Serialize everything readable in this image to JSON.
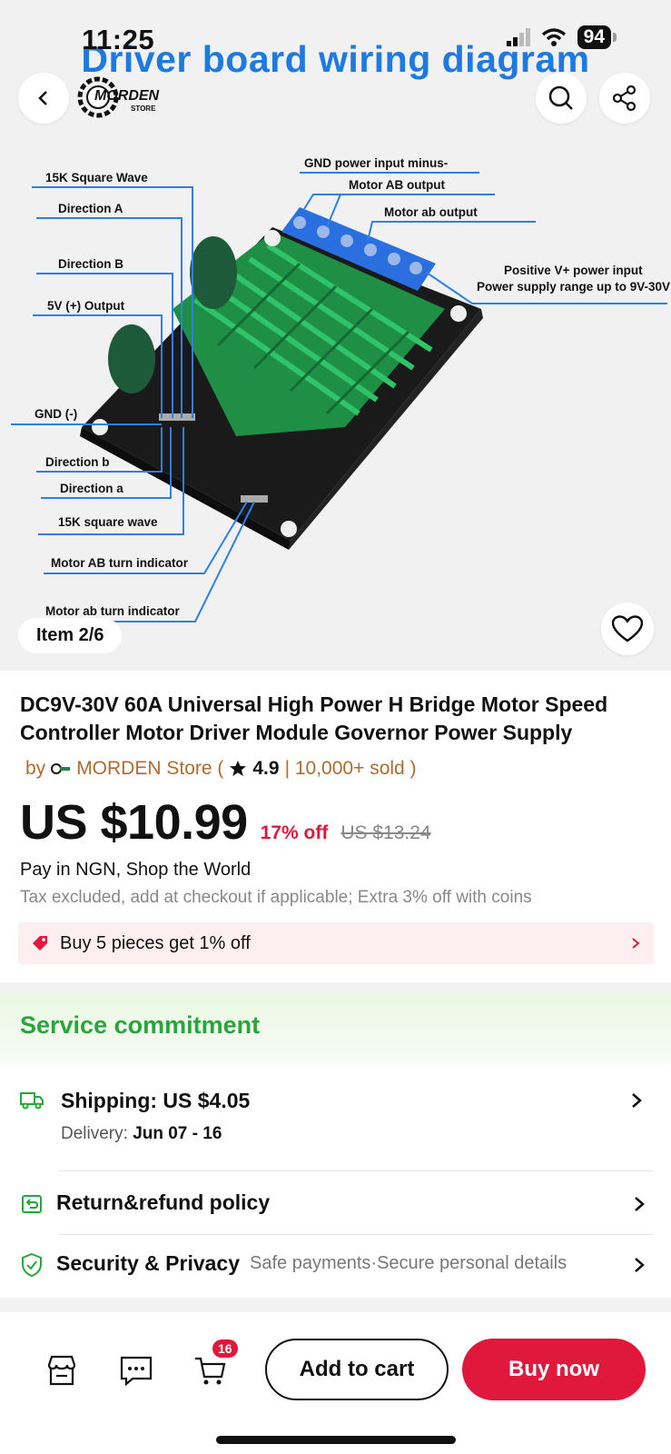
{
  "status_bar": {
    "time": "11:25",
    "battery": "94"
  },
  "hero": {
    "title": "Driver board wiring diagram",
    "logo_text": "MORDEN",
    "logo_sub": "STORE",
    "item_counter": "Item 2/6",
    "labels": {
      "sq_wave_15k": "15K Square Wave",
      "direction_A": "Direction A",
      "direction_B": "Direction B",
      "out_5v": "5V (+) Output",
      "gnd": "GND  (-)",
      "direction_b": "Direction b",
      "direction_a": "Direction a",
      "sq_wave_15k_lower": "15K square wave",
      "motor_AB_turn": "Motor AB turn indicator",
      "motor_ab_turn": "Motor ab turn indicator",
      "gnd_power": "GND power input minus-",
      "motor_AB_out": "Motor AB output",
      "motor_ab_out": "Motor ab output",
      "pos_power": "Positive V+ power input",
      "power_range": "Power supply range up to 9V-30V"
    },
    "icons": {
      "back": "back-arrow-icon",
      "search": "search-icon",
      "share": "share-icon",
      "wishlist": "heart-icon"
    }
  },
  "product": {
    "title": "DC9V-30V 60A Universal High Power H Bridge Motor Speed Controller Motor Driver Module Governor Power Supply",
    "store_prefix": "by",
    "store_name": "MORDEN Store (",
    "rating": "4.9",
    "sold": "| 10,000+ sold )",
    "price": "US $10.99",
    "discount": "17% off",
    "original_price": "US $13.24",
    "pay_line": "Pay in NGN, Shop the World",
    "tax_line": "Tax excluded, add at checkout if applicable; Extra 3% off with coins",
    "promo": "Buy 5 pieces get 1% off"
  },
  "service": {
    "heading": "Service commitment",
    "shipping_title": "Shipping: US $4.05",
    "delivery_label": "Delivery:",
    "delivery_dates": "Jun 07 - 16",
    "return_title": "Return&refund policy",
    "security_title": "Security & Privacy",
    "security_sub": "Safe payments·Secure personal details"
  },
  "bottom_bar": {
    "cart_count": "16",
    "add_to_cart": "Add to cart",
    "buy_now": "Buy now"
  },
  "colors": {
    "accent_red": "#e0193c",
    "service_green": "#28a53c",
    "store_brown": "#b06b2f",
    "diagram_blue": "#1d7ae0"
  }
}
